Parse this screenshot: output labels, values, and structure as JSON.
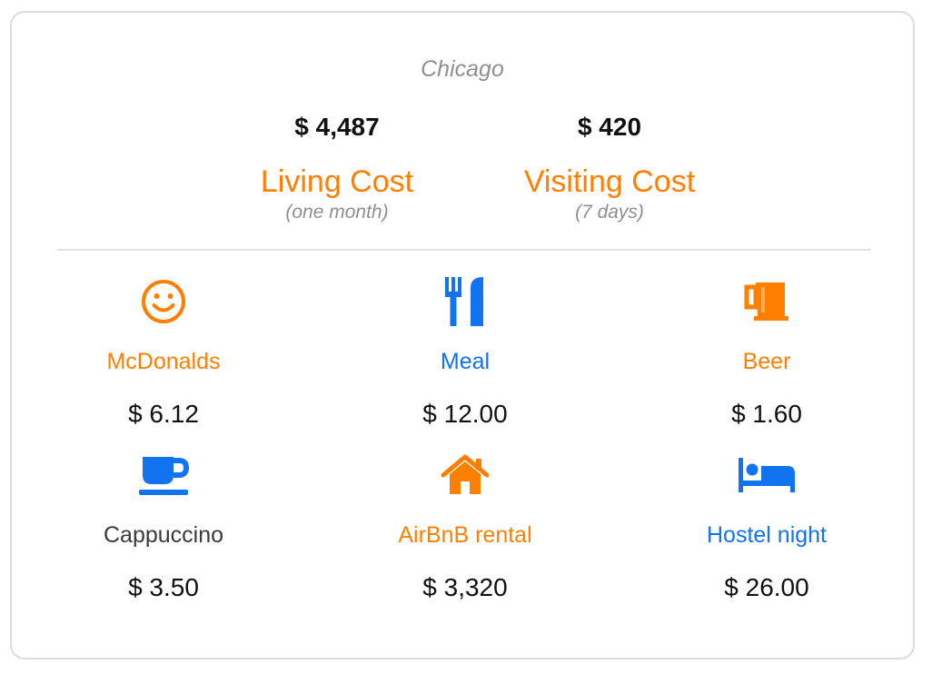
{
  "city": "Chicago",
  "summary": {
    "living": {
      "amount": "$ 4,487",
      "label": "Living Cost",
      "period": "(one month)"
    },
    "visiting": {
      "amount": "$ 420",
      "label": "Visiting Cost",
      "period": "(7 days)"
    }
  },
  "items": [
    {
      "name": "McDonalds",
      "price": "$ 6.12",
      "icon": "smiley-face-icon",
      "color": "#ff8000"
    },
    {
      "name": "Meal",
      "price": "$ 12.00",
      "icon": "fork-knife-icon",
      "color": "#1273f0"
    },
    {
      "name": "Beer",
      "price": "$ 1.60",
      "icon": "beer-mug-icon",
      "color": "#ff8000"
    },
    {
      "name": "Cappuccino",
      "price": "$ 3.50",
      "icon": "coffee-cup-icon",
      "color": "#1273f0"
    },
    {
      "name": "AirBnB rental",
      "price": "$ 3,320",
      "icon": "house-icon",
      "color": "#ff8000"
    },
    {
      "name": "Hostel night",
      "price": "$ 26.00",
      "icon": "bed-icon",
      "color": "#1273f0"
    }
  ],
  "colors": {
    "accent_orange": "#ff8000",
    "accent_blue": "#1273f0",
    "muted_gray": "#8f8f8f"
  }
}
